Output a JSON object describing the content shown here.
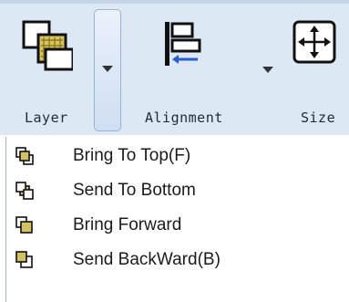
{
  "ribbon": {
    "layer_label": "Layer",
    "alignment_label": "Alignment",
    "size_label": "Size",
    "layer_icon": "layer-icon",
    "alignment_icon": "align-left-icon",
    "size_icon": "move-arrows-icon",
    "dropdown_icon": "chevron-down-icon"
  },
  "menu": {
    "items": [
      {
        "label": "Bring To Top(F)",
        "icon": "bring-to-top-icon"
      },
      {
        "label": "Send To Bottom",
        "icon": "send-to-bottom-icon"
      },
      {
        "label": "Bring Forward",
        "icon": "bring-forward-icon"
      },
      {
        "label": "Send BackWard(B)",
        "icon": "send-backward-icon"
      }
    ]
  },
  "colors": {
    "ribbon_bg": "#dde8f5",
    "layer_square": "#c9b24a",
    "layer_frame": "#1a1a1a"
  }
}
